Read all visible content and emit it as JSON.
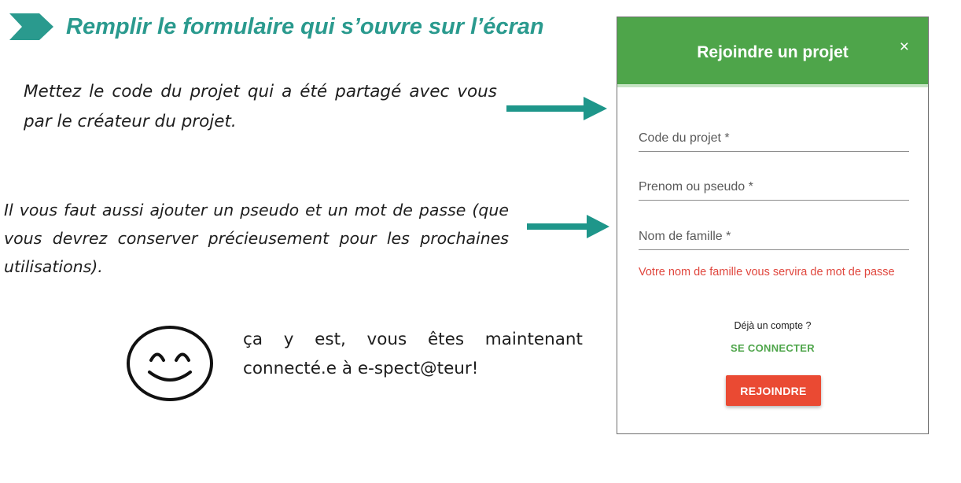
{
  "instructions": {
    "heading": "Remplir le formulaire qui s’ouvre sur l’écran",
    "paragraph_code": "Mettez le code du projet qui a été partagé avec vous par le créateur du projet.",
    "paragraph_pseudo": "Il vous faut aussi ajouter un pseudo et un mot de passe (que vous devrez conserver précieusement pour les prochaines utilisations).",
    "done_text": "ça y est, vous êtes maintenant connecté.e à e-spect@teur!",
    "icons": [
      "chevron-right-icon",
      "arrow-right-icon",
      "smiley-icon"
    ]
  },
  "dialog": {
    "title": "Rejoindre un projet",
    "close_icon": "×",
    "fields": [
      {
        "label": "Code du projet *",
        "value": ""
      },
      {
        "label": "Prenom ou pseudo *",
        "value": ""
      },
      {
        "label": "Nom de famille *",
        "value": ""
      }
    ],
    "hint": "Votre nom de famille vous servira de mot de passe",
    "already_account": "Déjà un compte ?",
    "connect_link": "SE CONNECTER",
    "join_button": "REJOINDRE"
  },
  "colors": {
    "teal_accent": "#2a9a8e",
    "header_green": "#4ea54a",
    "link_green": "#4ea54a",
    "hint_red": "#e0473e",
    "button_red": "#ea4a33"
  }
}
